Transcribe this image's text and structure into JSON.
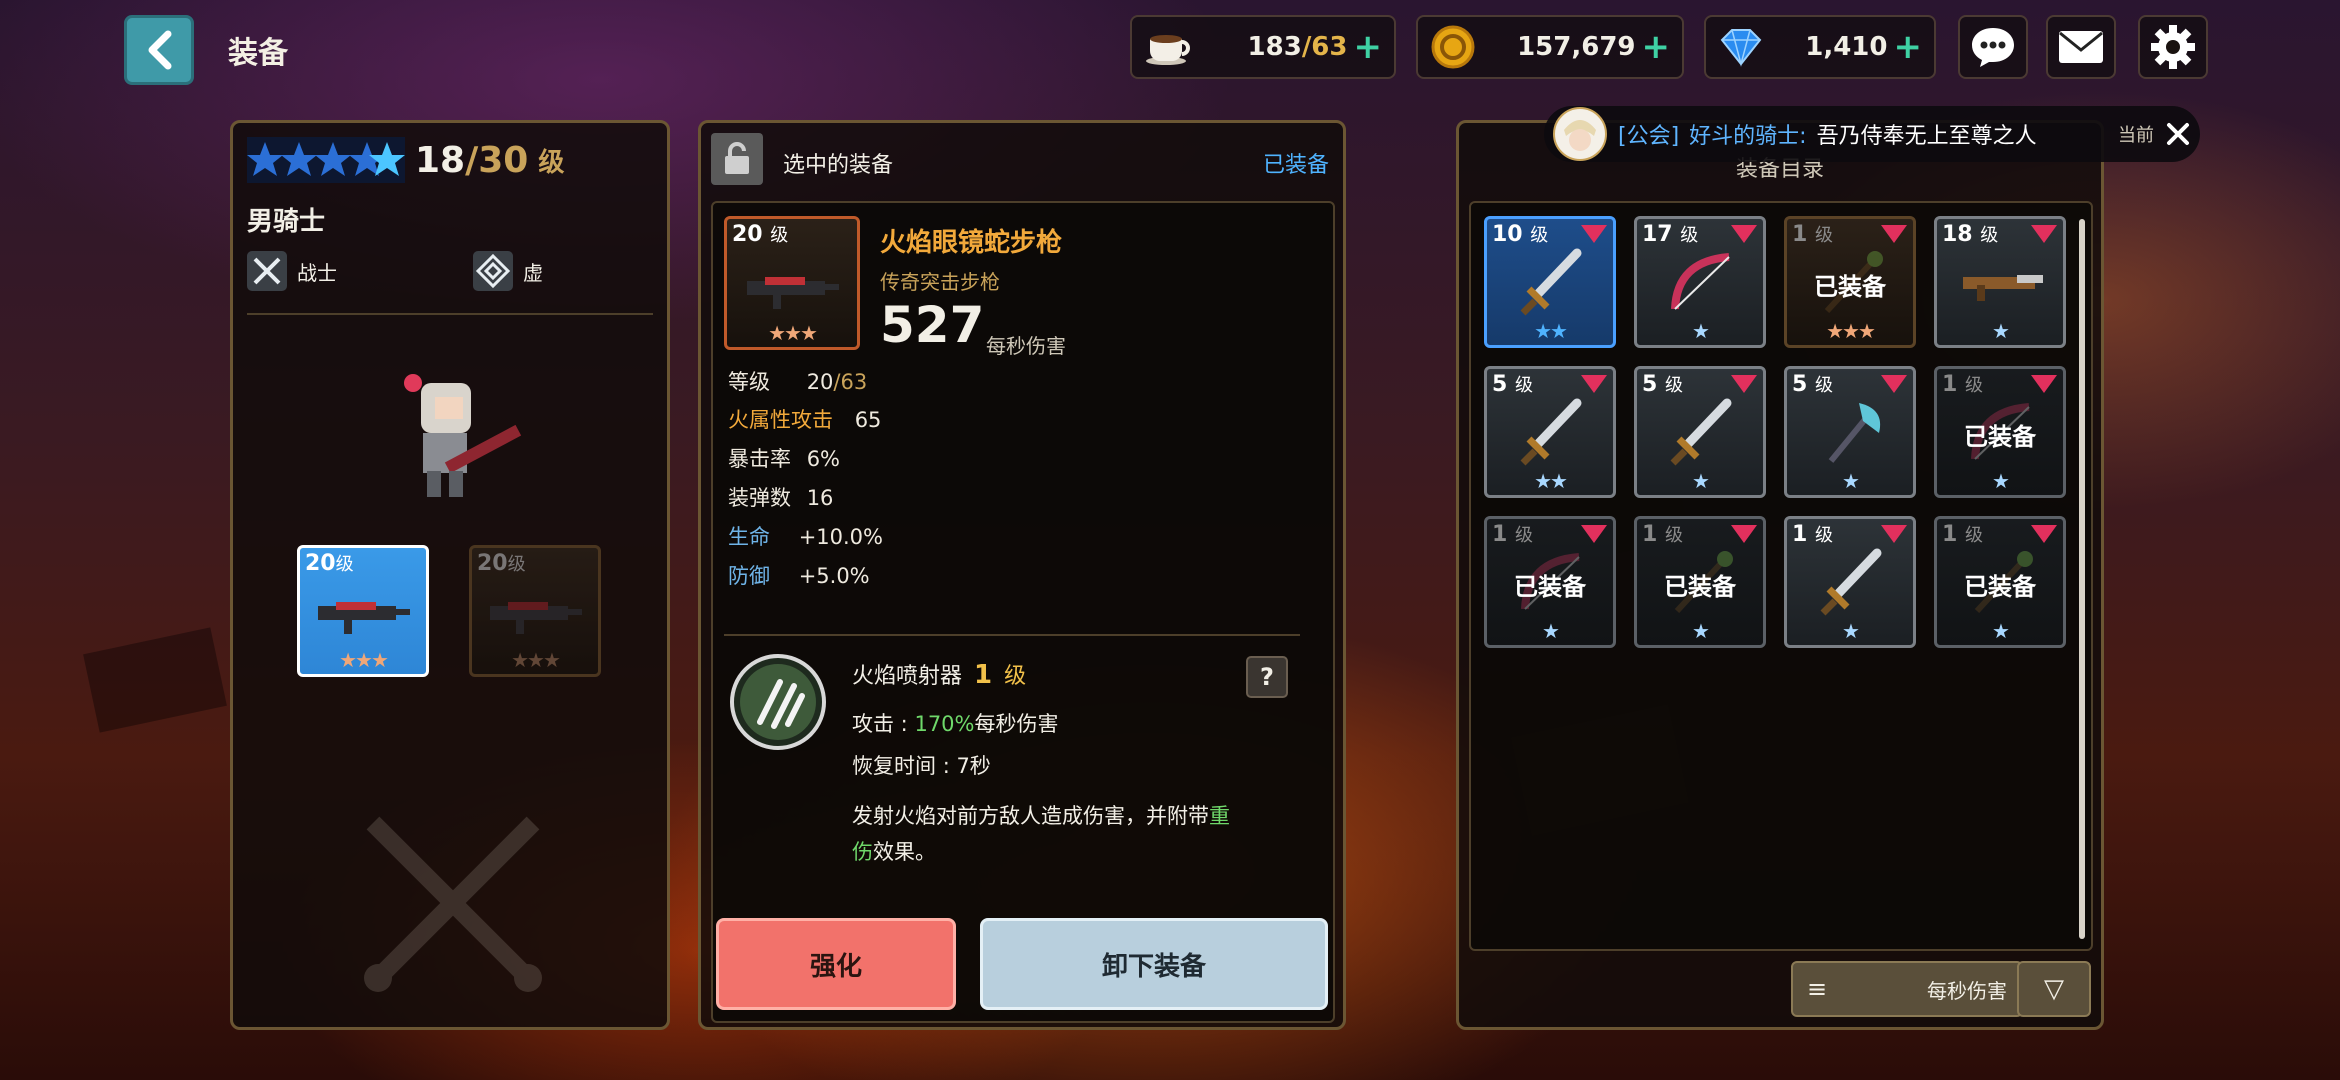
{
  "header": {
    "title": "装备"
  },
  "resources": {
    "stamina": {
      "current": "183",
      "max": "/63"
    },
    "gold": "157,679",
    "gems": "1,410"
  },
  "hero": {
    "level": "18",
    "max_level": "/30",
    "level_unit": "级",
    "name": "男骑士",
    "class_label": "战士",
    "element_label": "虚",
    "weapon_slot_1_level": "20",
    "weapon_slot_2_level": "20",
    "level_suffix": "级"
  },
  "selected": {
    "header_label": "选中的装备",
    "equipped_tag": "已装备",
    "item_level": "20",
    "item_level_unit": "级",
    "name": "火焰眼镜蛇步枪",
    "rarity_type": "传奇突击步枪",
    "dps": "527",
    "dps_label": "每秒伤害",
    "stats": [
      {
        "key": "等级",
        "value": "20",
        "value2": "/63",
        "key_color": "#efeadf"
      },
      {
        "key": "火属性攻击",
        "value": "65",
        "value2": "",
        "key_color": "#f2a93b"
      },
      {
        "key": "暴击率",
        "value": "6%",
        "value2": "",
        "key_color": "#efeadf"
      },
      {
        "key": "装弹数",
        "value": "16",
        "value2": "",
        "key_color": "#efeadf"
      },
      {
        "key": "生命",
        "value": "+10.0%",
        "value2": "",
        "key_color": "#6fb4e8"
      },
      {
        "key": "防御",
        "value": "+5.0%",
        "value2": "",
        "key_color": "#6fb4e8"
      }
    ],
    "skill": {
      "name": "火焰喷射器",
      "level": "1",
      "level_unit": "级",
      "attack_label": "攻击 :",
      "attack_value": "170%",
      "attack_suffix": "每秒伤害",
      "cooldown_label": "恢复时间",
      "cooldown_value": ":  7秒",
      "desc_1": "发射火焰对前方敌人造成伤害，并附带",
      "desc_hl_1": "重",
      "desc_hl_2": "伤",
      "desc_2": "效果。",
      "help": "?"
    },
    "upgrade_label": "强化",
    "unequip_label": "卸下装备"
  },
  "chat": {
    "channel": "[公会]",
    "sender": "好斗的骑士:",
    "message": "吾乃侍奉无上至尊之人",
    "tag": "当前"
  },
  "catalog": {
    "title": "装备目录",
    "sort_label": "每秒伤害",
    "items": [
      {
        "level": "10",
        "equipped": "",
        "stars": "★★",
        "star_color": "#4fb3ff",
        "variant": "sel",
        "icon": "sword-icon"
      },
      {
        "level": "17",
        "equipped": "",
        "stars": "★",
        "star_color": "#a9d8ff",
        "variant": "",
        "icon": "bow-icon"
      },
      {
        "level": "1",
        "equipped": "已装备",
        "stars": "★★★",
        "star_color": "#f0a778",
        "variant": "brown",
        "icon": "staff-icon"
      },
      {
        "level": "18",
        "equipped": "",
        "stars": "★",
        "star_color": "#a9d8ff",
        "variant": "",
        "icon": "rifle-icon"
      },
      {
        "level": "5",
        "equipped": "",
        "stars": "★★",
        "star_color": "#a9d8ff",
        "variant": "",
        "icon": "sword-icon"
      },
      {
        "level": "5",
        "equipped": "",
        "stars": "★",
        "star_color": "#a9d8ff",
        "variant": "",
        "icon": "sword-icon"
      },
      {
        "level": "5",
        "equipped": "",
        "stars": "★",
        "star_color": "#a9d8ff",
        "variant": "",
        "icon": "axe-icon"
      },
      {
        "level": "1",
        "equipped": "已装备",
        "stars": "★",
        "star_color": "#a9d8ff",
        "variant": "dark",
        "icon": "bow-icon"
      },
      {
        "level": "1",
        "equipped": "已装备",
        "stars": "★",
        "star_color": "#a9d8ff",
        "variant": "dark",
        "icon": "bow-icon"
      },
      {
        "level": "1",
        "equipped": "已装备",
        "stars": "★",
        "star_color": "#a9d8ff",
        "variant": "dark",
        "icon": "staff-icon"
      },
      {
        "level": "1",
        "equipped": "",
        "stars": "★",
        "star_color": "#a9d8ff",
        "variant": "",
        "icon": "sword-icon"
      },
      {
        "level": "1",
        "equipped": "已装备",
        "stars": "★",
        "star_color": "#a9d8ff",
        "variant": "dark",
        "icon": "staff-icon"
      }
    ]
  }
}
